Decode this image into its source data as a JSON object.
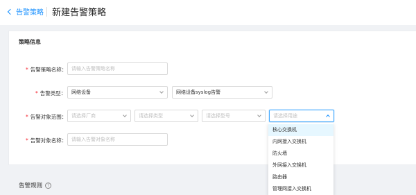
{
  "header": {
    "back_label": "告警策略",
    "title": "新建告警策略"
  },
  "section": {
    "title": "策略信息"
  },
  "form": {
    "policy_name": {
      "label": "告警策略名称：",
      "placeholder": "请输入告警策略名称"
    },
    "alarm_type": {
      "label": "告警类型：",
      "value_1": "网络设备",
      "value_2": "网络设备syslog告警"
    },
    "target_scope": {
      "label": "告警对象范围：",
      "vendor_placeholder": "请选择厂商",
      "type_placeholder": "请选择类型",
      "model_placeholder": "请选择型号",
      "usage_placeholder": "请选择用途"
    },
    "target_name": {
      "label": "告警对象名称：",
      "placeholder": "请输入告警对象名称"
    }
  },
  "dropdown": {
    "options": [
      "核心交换机",
      "内网接入交换机",
      "防火墙",
      "外网接入交换机",
      "路由器",
      "管理网接入交换机"
    ]
  },
  "rules": {
    "title": "告警规则",
    "help_icon": "?"
  }
}
